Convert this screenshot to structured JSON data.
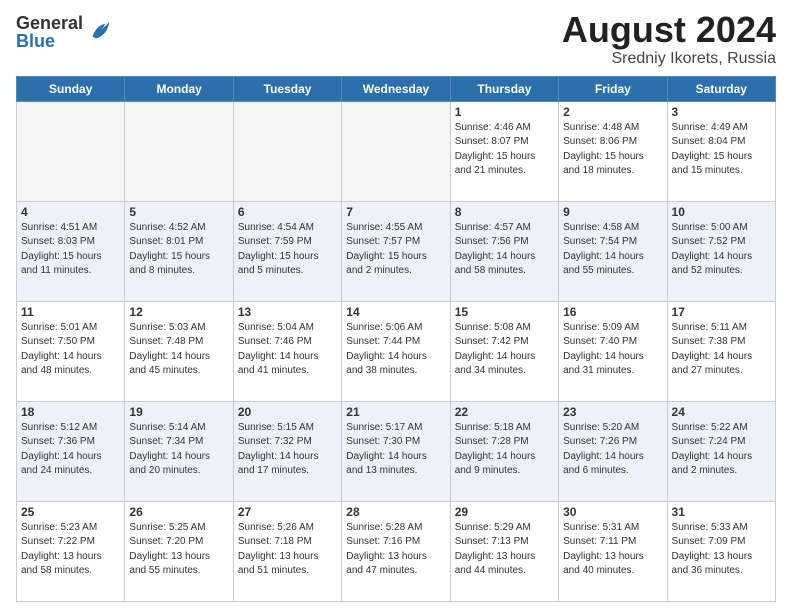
{
  "header": {
    "logo_general": "General",
    "logo_blue": "Blue",
    "month_year": "August 2024",
    "location": "Sredniy Ikorets, Russia"
  },
  "days_of_week": [
    "Sunday",
    "Monday",
    "Tuesday",
    "Wednesday",
    "Thursday",
    "Friday",
    "Saturday"
  ],
  "weeks": [
    [
      {
        "day": "",
        "info": ""
      },
      {
        "day": "",
        "info": ""
      },
      {
        "day": "",
        "info": ""
      },
      {
        "day": "",
        "info": ""
      },
      {
        "day": "1",
        "info": "Sunrise: 4:46 AM\nSunset: 8:07 PM\nDaylight: 15 hours\nand 21 minutes."
      },
      {
        "day": "2",
        "info": "Sunrise: 4:48 AM\nSunset: 8:06 PM\nDaylight: 15 hours\nand 18 minutes."
      },
      {
        "day": "3",
        "info": "Sunrise: 4:49 AM\nSunset: 8:04 PM\nDaylight: 15 hours\nand 15 minutes."
      }
    ],
    [
      {
        "day": "4",
        "info": "Sunrise: 4:51 AM\nSunset: 8:03 PM\nDaylight: 15 hours\nand 11 minutes."
      },
      {
        "day": "5",
        "info": "Sunrise: 4:52 AM\nSunset: 8:01 PM\nDaylight: 15 hours\nand 8 minutes."
      },
      {
        "day": "6",
        "info": "Sunrise: 4:54 AM\nSunset: 7:59 PM\nDaylight: 15 hours\nand 5 minutes."
      },
      {
        "day": "7",
        "info": "Sunrise: 4:55 AM\nSunset: 7:57 PM\nDaylight: 15 hours\nand 2 minutes."
      },
      {
        "day": "8",
        "info": "Sunrise: 4:57 AM\nSunset: 7:56 PM\nDaylight: 14 hours\nand 58 minutes."
      },
      {
        "day": "9",
        "info": "Sunrise: 4:58 AM\nSunset: 7:54 PM\nDaylight: 14 hours\nand 55 minutes."
      },
      {
        "day": "10",
        "info": "Sunrise: 5:00 AM\nSunset: 7:52 PM\nDaylight: 14 hours\nand 52 minutes."
      }
    ],
    [
      {
        "day": "11",
        "info": "Sunrise: 5:01 AM\nSunset: 7:50 PM\nDaylight: 14 hours\nand 48 minutes."
      },
      {
        "day": "12",
        "info": "Sunrise: 5:03 AM\nSunset: 7:48 PM\nDaylight: 14 hours\nand 45 minutes."
      },
      {
        "day": "13",
        "info": "Sunrise: 5:04 AM\nSunset: 7:46 PM\nDaylight: 14 hours\nand 41 minutes."
      },
      {
        "day": "14",
        "info": "Sunrise: 5:06 AM\nSunset: 7:44 PM\nDaylight: 14 hours\nand 38 minutes."
      },
      {
        "day": "15",
        "info": "Sunrise: 5:08 AM\nSunset: 7:42 PM\nDaylight: 14 hours\nand 34 minutes."
      },
      {
        "day": "16",
        "info": "Sunrise: 5:09 AM\nSunset: 7:40 PM\nDaylight: 14 hours\nand 31 minutes."
      },
      {
        "day": "17",
        "info": "Sunrise: 5:11 AM\nSunset: 7:38 PM\nDaylight: 14 hours\nand 27 minutes."
      }
    ],
    [
      {
        "day": "18",
        "info": "Sunrise: 5:12 AM\nSunset: 7:36 PM\nDaylight: 14 hours\nand 24 minutes."
      },
      {
        "day": "19",
        "info": "Sunrise: 5:14 AM\nSunset: 7:34 PM\nDaylight: 14 hours\nand 20 minutes."
      },
      {
        "day": "20",
        "info": "Sunrise: 5:15 AM\nSunset: 7:32 PM\nDaylight: 14 hours\nand 17 minutes."
      },
      {
        "day": "21",
        "info": "Sunrise: 5:17 AM\nSunset: 7:30 PM\nDaylight: 14 hours\nand 13 minutes."
      },
      {
        "day": "22",
        "info": "Sunrise: 5:18 AM\nSunset: 7:28 PM\nDaylight: 14 hours\nand 9 minutes."
      },
      {
        "day": "23",
        "info": "Sunrise: 5:20 AM\nSunset: 7:26 PM\nDaylight: 14 hours\nand 6 minutes."
      },
      {
        "day": "24",
        "info": "Sunrise: 5:22 AM\nSunset: 7:24 PM\nDaylight: 14 hours\nand 2 minutes."
      }
    ],
    [
      {
        "day": "25",
        "info": "Sunrise: 5:23 AM\nSunset: 7:22 PM\nDaylight: 13 hours\nand 58 minutes."
      },
      {
        "day": "26",
        "info": "Sunrise: 5:25 AM\nSunset: 7:20 PM\nDaylight: 13 hours\nand 55 minutes."
      },
      {
        "day": "27",
        "info": "Sunrise: 5:26 AM\nSunset: 7:18 PM\nDaylight: 13 hours\nand 51 minutes."
      },
      {
        "day": "28",
        "info": "Sunrise: 5:28 AM\nSunset: 7:16 PM\nDaylight: 13 hours\nand 47 minutes."
      },
      {
        "day": "29",
        "info": "Sunrise: 5:29 AM\nSunset: 7:13 PM\nDaylight: 13 hours\nand 44 minutes."
      },
      {
        "day": "30",
        "info": "Sunrise: 5:31 AM\nSunset: 7:11 PM\nDaylight: 13 hours\nand 40 minutes."
      },
      {
        "day": "31",
        "info": "Sunrise: 5:33 AM\nSunset: 7:09 PM\nDaylight: 13 hours\nand 36 minutes."
      }
    ]
  ]
}
